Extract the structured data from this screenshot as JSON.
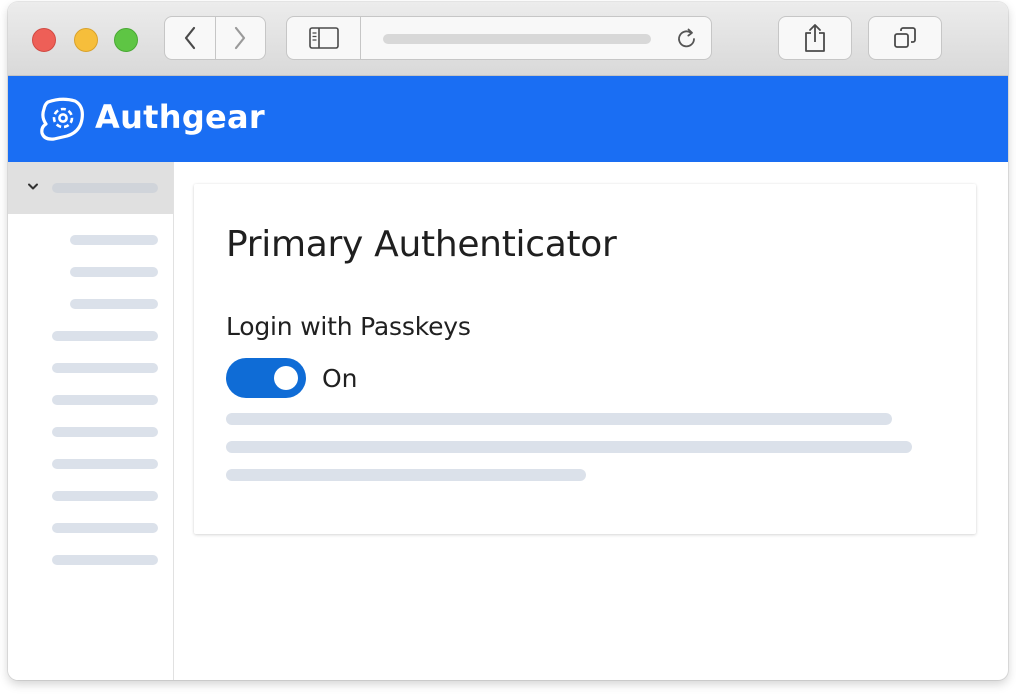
{
  "browser": {
    "toolbar_icons": [
      "back-chevron-icon",
      "forward-chevron-icon",
      "sidebar-icon",
      "reload-icon",
      "share-icon",
      "tabs-icon"
    ]
  },
  "header": {
    "brand": "Authgear",
    "accent_color": "#1a6ef3"
  },
  "main": {
    "card_title": "Primary Authenticator",
    "field_label": "Login with Passkeys",
    "toggle_state": "On",
    "toggle_on": true,
    "toggle_color": "#0f6cd6"
  }
}
